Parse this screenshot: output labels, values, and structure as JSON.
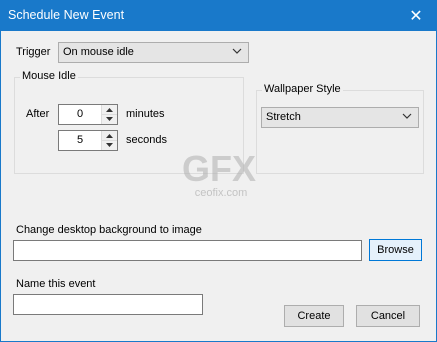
{
  "window": {
    "title": "Schedule New Event",
    "close_glyph": "✕"
  },
  "trigger": {
    "label": "Trigger",
    "selected": "On mouse idle"
  },
  "mouse_idle": {
    "group_label": "Mouse Idle",
    "after_label": "After",
    "minutes_value": "0",
    "minutes_label": "minutes",
    "seconds_value": "5",
    "seconds_label": "seconds"
  },
  "wallpaper_style": {
    "group_label": "Wallpaper Style",
    "selected": "Stretch"
  },
  "watermark": {
    "logo_text": "GFX",
    "site_text": "ceofix.com"
  },
  "image": {
    "label": "Change desktop background to image",
    "path_value": "",
    "browse_label": "Browse"
  },
  "event_name": {
    "label": "Name this event",
    "value": ""
  },
  "actions": {
    "create_label": "Create",
    "cancel_label": "Cancel"
  },
  "colors": {
    "titlebar": "#1979ca",
    "focus_border": "#0078d7"
  }
}
